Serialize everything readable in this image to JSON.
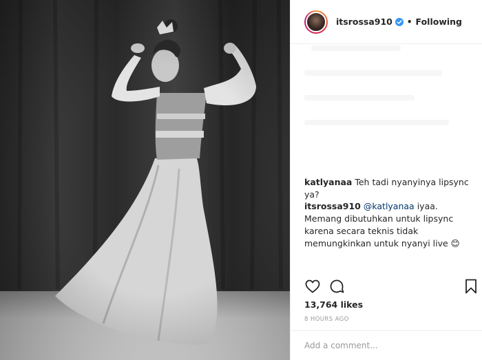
{
  "post": {
    "username": "itsrossa910",
    "follow_status": "Following",
    "separator": "•"
  },
  "comments": [
    {
      "user": "katlyanaa",
      "text": "Teh tadi nyanyinya lipsync ya?"
    },
    {
      "user": "itsrossa910",
      "mention": "@katlyanaa",
      "text": " iyaa. Memang dibutuhkan untuk lipsync karena secara teknis tidak memungkinkan untuk nyanyi live ",
      "emoji": "😊"
    }
  ],
  "stats": {
    "likes": "13,764 likes",
    "time": "8 HOURS AGO"
  },
  "add_comment": {
    "placeholder": "Add a comment..."
  },
  "icons": [
    "heart-icon",
    "comment-icon",
    "bookmark-icon",
    "verified-badge-icon"
  ],
  "colors": {
    "verified": "#3897f0",
    "mention": "#003569",
    "muted": "#999999"
  }
}
